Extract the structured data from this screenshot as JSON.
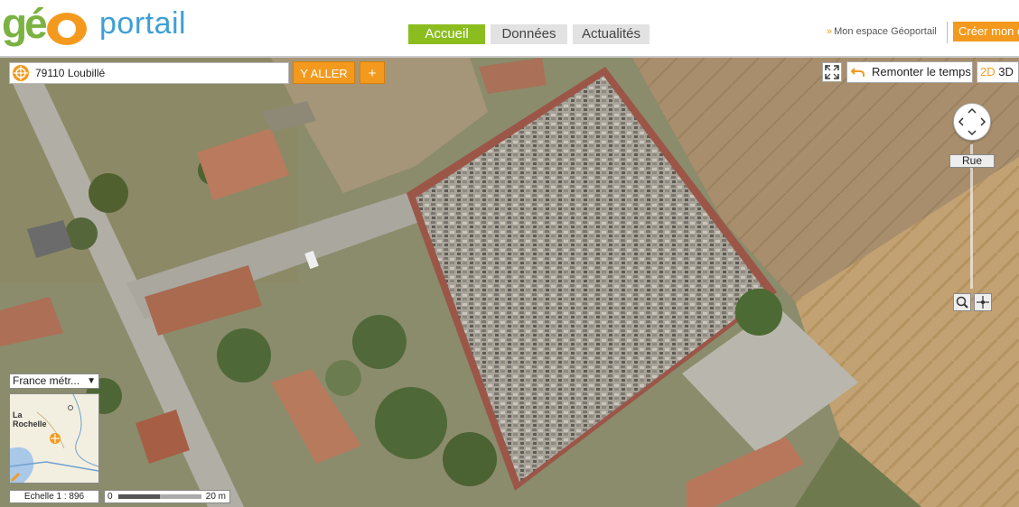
{
  "header": {
    "logo": {
      "part1": "géo",
      "part2": "portail"
    },
    "nav": [
      {
        "label": "Accueil",
        "active": true
      },
      {
        "label": "Données",
        "active": false
      },
      {
        "label": "Actualités",
        "active": false
      }
    ],
    "espace_link": "Mon espace Géoportail",
    "creer_button": "Créer mon e"
  },
  "search": {
    "value": "79110 Loubillé",
    "go_label": "Y ALLER",
    "plus_label": "+"
  },
  "controls": {
    "remonter_label": "Remonter le temps",
    "mode_2d": "2D",
    "mode_3d": "3D",
    "zoom_level_label": "Rue"
  },
  "minimap": {
    "region": "France métr...",
    "city_label": "La Rochelle"
  },
  "scale": {
    "ratio_text": "Echelle 1 :  896",
    "bar_start": "0",
    "bar_end": "20 m"
  },
  "colors": {
    "accent_orange": "#f39a1e",
    "nav_active": "#8bbd1f",
    "logo_blue": "#3f9fd5"
  }
}
